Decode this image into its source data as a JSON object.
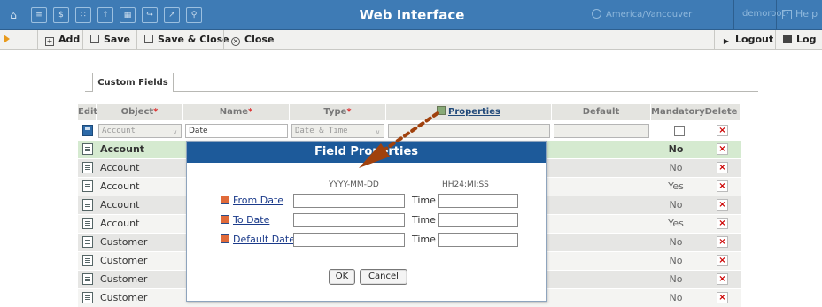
{
  "header": {
    "title": "Web Interface",
    "timezone": "America/Vancouver",
    "user": "demoroot",
    "help_label": "Help",
    "icons": [
      "home-icon",
      "list-icon",
      "dollar-icon",
      "modules-icon",
      "upload-icon",
      "grid-icon",
      "import-icon",
      "chart-icon",
      "search-icon"
    ]
  },
  "toolbar": {
    "add_label": "Add",
    "save_label": "Save",
    "save_close_label": "Save & Close",
    "close_label": "Close",
    "logout_label": "Logout",
    "log_label": "Log"
  },
  "tabs": [
    {
      "label": "Custom Fields"
    }
  ],
  "table": {
    "columns": {
      "edit": "Edit",
      "object": "Object",
      "name": "Name",
      "type": "Type",
      "properties": "Properties",
      "default": "Default",
      "mandatory": "Mandatory",
      "delete": "Delete"
    },
    "required_mark": "*",
    "new_row": {
      "object": "Account",
      "name": "Date",
      "type": "Date & Time"
    },
    "rows": [
      {
        "object": "Account",
        "mandatory": "No"
      },
      {
        "object": "Account",
        "mandatory": "No"
      },
      {
        "object": "Account",
        "mandatory": "Yes"
      },
      {
        "object": "Account",
        "mandatory": "No"
      },
      {
        "object": "Account",
        "mandatory": "Yes"
      },
      {
        "object": "Customer",
        "mandatory": "No"
      },
      {
        "object": "Customer",
        "mandatory": "No"
      },
      {
        "object": "Customer",
        "mandatory": "No"
      },
      {
        "object": "Customer",
        "mandatory": "No"
      }
    ]
  },
  "dialog": {
    "title": "Field Properties",
    "date_format": "YYYY-MM-DD",
    "time_format": "HH24:MI:SS",
    "from_date_label": "From Date",
    "to_date_label": "To Date",
    "default_date_label": "Default Date",
    "time_label": "Time",
    "ok_label": "OK",
    "cancel_label": "Cancel"
  },
  "colors": {
    "header_bg": "#3e7bb5",
    "dialog_title_bg": "#1d5a9a",
    "arrow": "#a0410d",
    "highlight_row": "#d5ead0"
  }
}
